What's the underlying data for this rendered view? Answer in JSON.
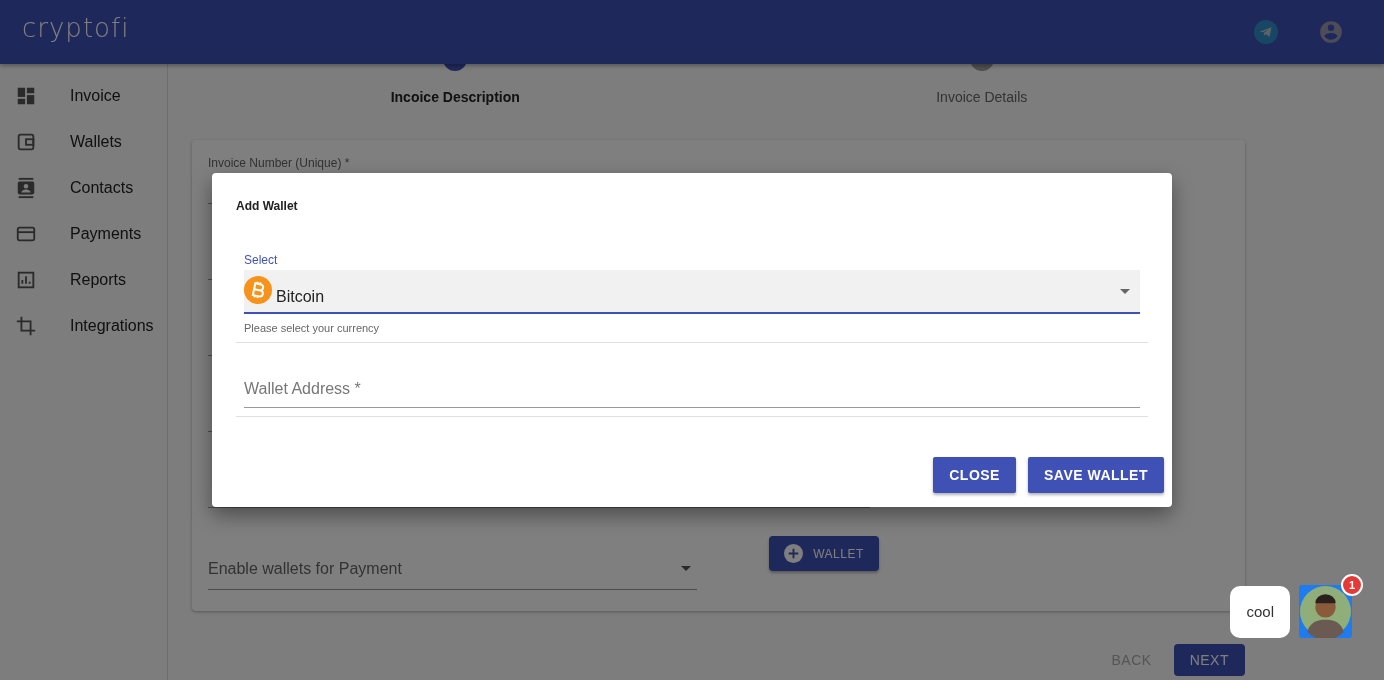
{
  "app": {
    "logo": "cryptofi"
  },
  "sidebar": {
    "items": [
      {
        "label": "Invoice",
        "kind": "dashboard"
      },
      {
        "label": "Wallets",
        "kind": "wallet"
      },
      {
        "label": "Contacts",
        "kind": "contacts"
      },
      {
        "label": "Payments",
        "kind": "card"
      },
      {
        "label": "Reports",
        "kind": "chart"
      },
      {
        "label": "Integrations",
        "kind": "crop"
      }
    ]
  },
  "stepper": {
    "steps": [
      {
        "title": "Incoice Description",
        "active": true
      },
      {
        "title": "Invoice Details",
        "active": false
      }
    ]
  },
  "form": {
    "fields": [
      {
        "label": "Invoice Number (Unique) *"
      }
    ],
    "wallet_select": {
      "placeholder": "Enable wallets for Payment"
    },
    "add_wallet_button": "WALLET"
  },
  "footer": {
    "buttons": [
      {
        "label": "BACK",
        "disabled": true
      },
      {
        "label": "NEXT",
        "disabled": false
      }
    ]
  },
  "dialog": {
    "title": "Add Wallet",
    "currency_select": {
      "label": "Select",
      "value": "Bitcoin",
      "helper": "Please select your currency"
    },
    "address_field": {
      "placeholder": "Wallet Address *"
    },
    "buttons": [
      "CLOSE",
      "SAVE WALLET"
    ]
  },
  "chat": {
    "message": "cool",
    "badge": "1"
  }
}
